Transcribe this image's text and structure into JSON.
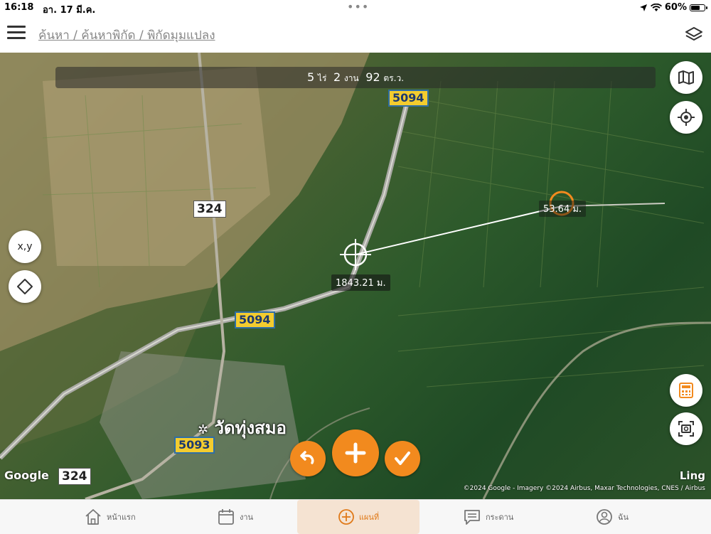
{
  "status": {
    "time": "16:18",
    "date": "อา. 17 มี.ค.",
    "battery": "60%",
    "battery_level": 0.6
  },
  "header": {
    "breadcrumb": "ค้นหา / ค้นหาพิกัด / พิกัดมุมแปลง"
  },
  "area": {
    "rai": "5",
    "rai_unit": "ไร่",
    "ngan": "2",
    "ngan_unit": "งาน",
    "wa": "92",
    "wa_unit": "ตร.ว."
  },
  "map": {
    "route_5094_top": "5094",
    "route_5094_mid": "5094",
    "route_5093": "5093",
    "route_324_top": "324",
    "route_324_bottom": "324",
    "distance_total": "1843.21 ม.",
    "distance_segment": "53.64 ม.",
    "place_name": "วัดทุ่งสมอ",
    "xy_button": "x,y",
    "google_label": "Google",
    "ling_label": "Ling",
    "copyright": "©2024 Google - Imagery ©2024 Airbus, Maxar Technologies, CNES / Airbus"
  },
  "colors": {
    "accent": "#f28a1e",
    "shield_yellow": "#f3cc2f",
    "shield_border": "#2e6ea6"
  },
  "tabs": [
    {
      "label": "หน้าแรก",
      "icon": "home-icon"
    },
    {
      "label": "งาน",
      "icon": "calendar-icon"
    },
    {
      "label": "แผนที่",
      "icon": "plus-circle-icon",
      "active": true
    },
    {
      "label": "กระดาน",
      "icon": "board-icon"
    },
    {
      "label": "ฉัน",
      "icon": "user-icon"
    }
  ]
}
